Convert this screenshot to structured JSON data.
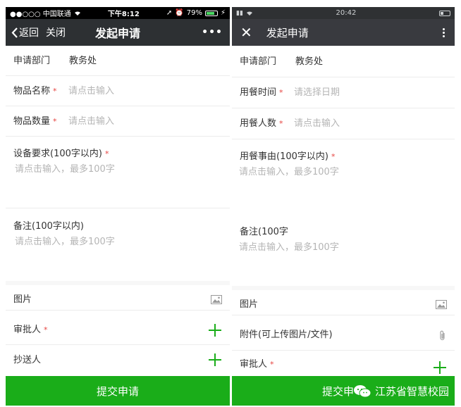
{
  "left": {
    "status": {
      "carrier": "●●○○○ 中国联通",
      "time": "下午8:12",
      "battery": "79%",
      "battery_level": 0.79
    },
    "nav": {
      "back": "返回",
      "close": "关闭",
      "title": "发起申请",
      "more": "•••"
    },
    "form": {
      "department_label": "申请部门",
      "department_value": "教务处",
      "item_name_label": "物品名称",
      "item_name_placeholder": "请点击输入",
      "item_qty_label": "物品数量",
      "item_qty_placeholder": "请点击输入",
      "equipment_label": "设备要求(100字以内)",
      "equipment_placeholder": "请点击输入，最多100字",
      "remark_label": "备注(100字以内)",
      "remark_placeholder": "请点击输入，最多100字",
      "picture_label": "图片",
      "approver_label": "审批人",
      "cc_label": "抄送人",
      "required_mark": "*"
    },
    "submit": "提交申请"
  },
  "right": {
    "status": {
      "time": "20:42"
    },
    "nav": {
      "title": "发起申请"
    },
    "form": {
      "department_label": "申请部门",
      "department_value": "教务处",
      "meal_time_label": "用餐时间",
      "meal_time_placeholder": "请选择日期",
      "meal_people_label": "用餐人数",
      "meal_people_placeholder": "请点击输入",
      "meal_reason_label": "用餐事由(100字以内)",
      "meal_reason_placeholder": "请点击输入，最多100字",
      "remark_label": "备注(100字",
      "remark_placeholder": "请点击输入，最多100字",
      "picture_label": "图片",
      "attachment_label": "附件(可上传图片/文件)",
      "approver_label": "审批人",
      "required_mark": "*"
    },
    "submit": "提交申",
    "watermark": "江苏省智慧校园"
  },
  "colors": {
    "accent": "#1aad19",
    "required": "#e64340",
    "nav": "#2d3033",
    "placeholder": "#b5b5b5"
  }
}
